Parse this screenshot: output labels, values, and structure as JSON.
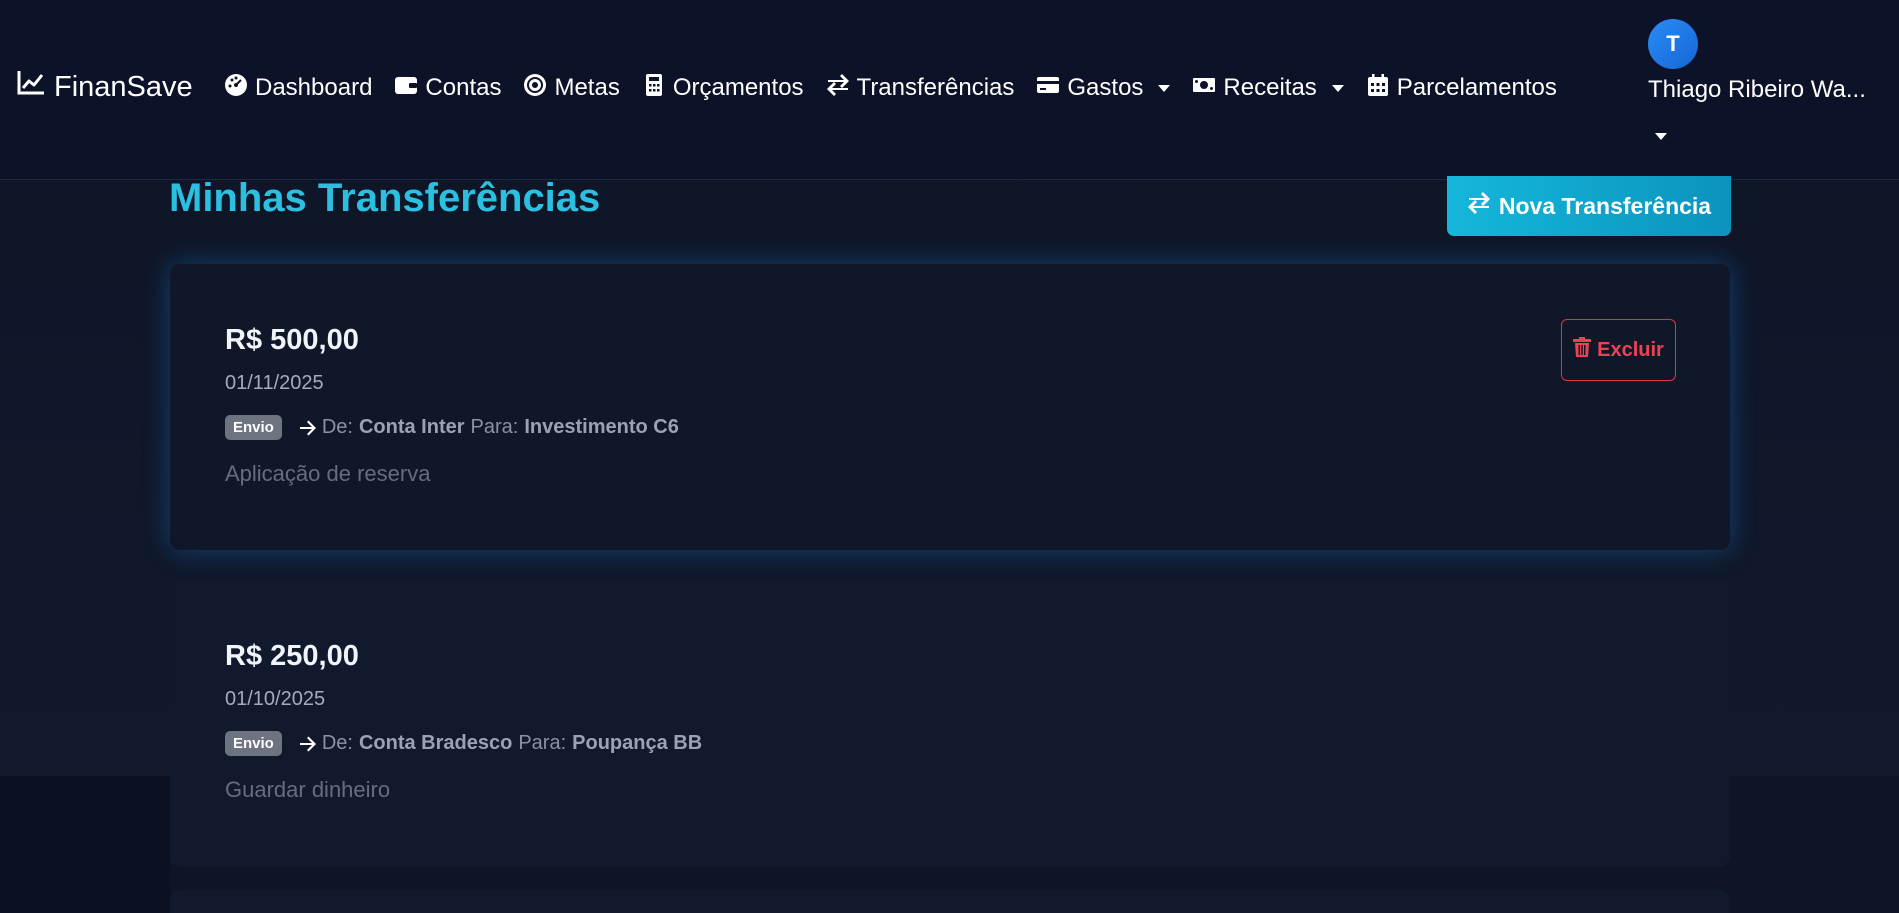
{
  "navbar": {
    "brand": "FinanSave",
    "items": [
      {
        "label": "Dashboard",
        "icon": "gauge-icon",
        "dropdown": false
      },
      {
        "label": "Contas",
        "icon": "wallet-icon",
        "dropdown": false
      },
      {
        "label": "Metas",
        "icon": "target-icon",
        "dropdown": false
      },
      {
        "label": "Orçamentos",
        "icon": "calculator-icon",
        "dropdown": false
      },
      {
        "label": "Transferências",
        "icon": "exchange-icon",
        "dropdown": false
      },
      {
        "label": "Gastos",
        "icon": "credit-card-icon",
        "dropdown": true
      },
      {
        "label": "Receitas",
        "icon": "money-bill-icon",
        "dropdown": true
      },
      {
        "label": "Parcelamentos",
        "icon": "calendar-icon",
        "dropdown": false
      }
    ],
    "user": {
      "initial": "T",
      "name": "Thiago Ribeiro Wa..."
    }
  },
  "page": {
    "title": "Minhas Transferências",
    "new_button": "Nova Transferência"
  },
  "transfers": [
    {
      "amount": "R$ 500,00",
      "date": "01/11/2025",
      "badge": "Envio",
      "from_label": "De:",
      "from": "Conta Inter",
      "to_label": "Para:",
      "to": "Investimento C6",
      "description": "Aplicação de reserva",
      "delete_label": "Excluir"
    },
    {
      "amount": "R$ 250,00",
      "date": "01/10/2025",
      "badge": "Envio",
      "from_label": "De:",
      "from": "Conta Bradesco",
      "to_label": "Para:",
      "to": "Poupança BB",
      "description": "Guardar dinheiro"
    }
  ],
  "colors": {
    "accent": "#2cc0e0",
    "danger": "#dc3545",
    "background": "#0f1526",
    "badge": "#6d737f"
  }
}
